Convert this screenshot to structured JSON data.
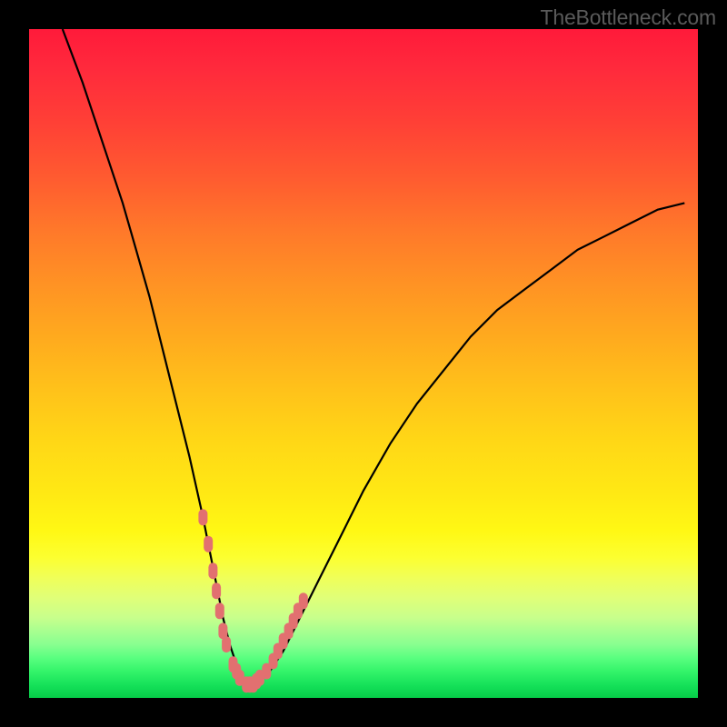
{
  "credit_text": "TheBottleneck.com",
  "colors": {
    "frame": "#000000",
    "curve": "#000000",
    "marker": "#e27070",
    "gradient_top": "#ff1a3a",
    "gradient_bottom": "#06cc48"
  },
  "chart_data": {
    "type": "line",
    "title": "",
    "xlabel": "",
    "ylabel": "",
    "xlim": [
      0,
      100
    ],
    "ylim": [
      0,
      100
    ],
    "series": [
      {
        "name": "bottleneck-curve",
        "x": [
          5,
          8,
          10,
          12,
          14,
          16,
          18,
          20,
          22,
          24,
          26,
          27,
          28,
          29,
          30,
          31,
          32,
          33,
          34,
          35,
          36,
          38,
          40,
          42,
          44,
          46,
          48,
          50,
          54,
          58,
          62,
          66,
          70,
          74,
          78,
          82,
          86,
          90,
          94,
          98
        ],
        "y": [
          100,
          92,
          86,
          80,
          74,
          67,
          60,
          52,
          44,
          36,
          27,
          22,
          17,
          12,
          8,
          5,
          3,
          2,
          2,
          3,
          4,
          7,
          11,
          15,
          19,
          23,
          27,
          31,
          38,
          44,
          49,
          54,
          58,
          61,
          64,
          67,
          69,
          71,
          73,
          74
        ]
      }
    ],
    "markers": {
      "name": "highlighted-points",
      "x": [
        26.0,
        26.8,
        27.5,
        28.0,
        28.5,
        29.0,
        29.5,
        30.5,
        31.0,
        31.5,
        32.5,
        33.0,
        33.5,
        34.0,
        34.5,
        35.5,
        36.5,
        37.2,
        38.0,
        38.8,
        39.5,
        40.2,
        41.0
      ],
      "y": [
        27,
        23,
        19,
        16,
        13,
        10,
        8,
        5,
        4,
        3,
        2,
        2,
        2,
        2.5,
        3,
        4,
        5.5,
        7,
        8.5,
        10,
        11.5,
        13,
        14.5
      ]
    }
  }
}
